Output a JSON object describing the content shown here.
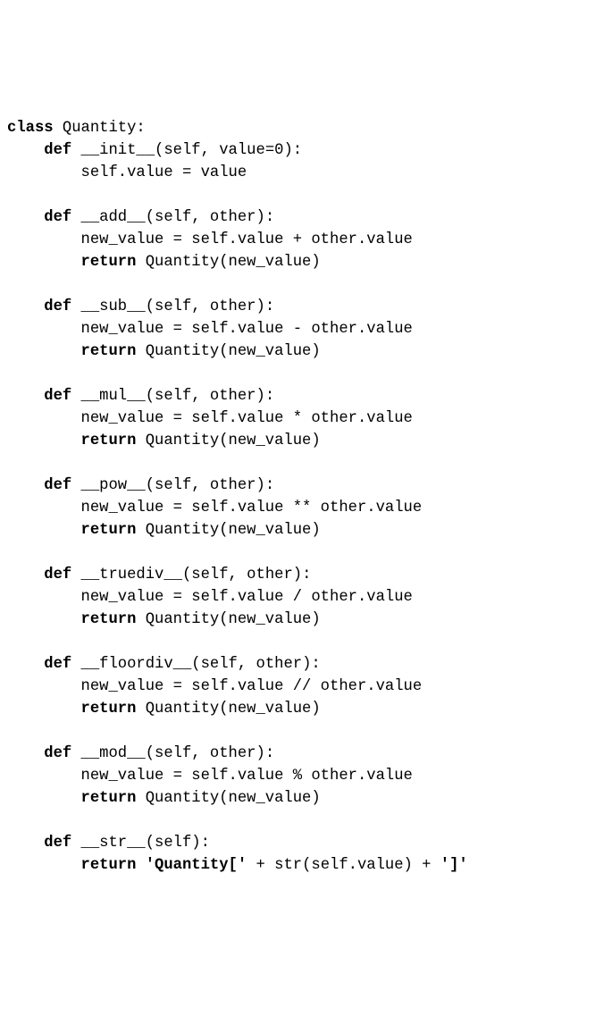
{
  "code": {
    "lines": [
      {
        "indent": 0,
        "segs": [
          {
            "t": "class ",
            "b": true
          },
          {
            "t": "Quantity:",
            "b": false
          }
        ]
      },
      {
        "indent": 1,
        "segs": [
          {
            "t": "def ",
            "b": true
          },
          {
            "t": "__init__(self, value=0):",
            "b": false
          }
        ]
      },
      {
        "indent": 2,
        "segs": [
          {
            "t": "self.value = value",
            "b": false
          }
        ]
      },
      {
        "indent": 0,
        "segs": [
          {
            "t": "",
            "b": false
          }
        ]
      },
      {
        "indent": 1,
        "segs": [
          {
            "t": "def ",
            "b": true
          },
          {
            "t": "__add__(self, other):",
            "b": false
          }
        ]
      },
      {
        "indent": 2,
        "segs": [
          {
            "t": "new_value = self.value + other.value",
            "b": false
          }
        ]
      },
      {
        "indent": 2,
        "segs": [
          {
            "t": "return ",
            "b": true
          },
          {
            "t": "Quantity(new_value)",
            "b": false
          }
        ]
      },
      {
        "indent": 0,
        "segs": [
          {
            "t": "",
            "b": false
          }
        ]
      },
      {
        "indent": 1,
        "segs": [
          {
            "t": "def ",
            "b": true
          },
          {
            "t": "__sub__(self, other):",
            "b": false
          }
        ]
      },
      {
        "indent": 2,
        "segs": [
          {
            "t": "new_value = self.value - other.value",
            "b": false
          }
        ]
      },
      {
        "indent": 2,
        "segs": [
          {
            "t": "return ",
            "b": true
          },
          {
            "t": "Quantity(new_value)",
            "b": false
          }
        ]
      },
      {
        "indent": 0,
        "segs": [
          {
            "t": "",
            "b": false
          }
        ]
      },
      {
        "indent": 1,
        "segs": [
          {
            "t": "def ",
            "b": true
          },
          {
            "t": "__mul__(self, other):",
            "b": false
          }
        ]
      },
      {
        "indent": 2,
        "segs": [
          {
            "t": "new_value = self.value * other.value",
            "b": false
          }
        ]
      },
      {
        "indent": 2,
        "segs": [
          {
            "t": "return ",
            "b": true
          },
          {
            "t": "Quantity(new_value)",
            "b": false
          }
        ]
      },
      {
        "indent": 0,
        "segs": [
          {
            "t": "",
            "b": false
          }
        ]
      },
      {
        "indent": 1,
        "segs": [
          {
            "t": "def ",
            "b": true
          },
          {
            "t": "__pow__(self, other):",
            "b": false
          }
        ]
      },
      {
        "indent": 2,
        "segs": [
          {
            "t": "new_value = self.value ** other.value",
            "b": false
          }
        ]
      },
      {
        "indent": 2,
        "segs": [
          {
            "t": "return ",
            "b": true
          },
          {
            "t": "Quantity(new_value)",
            "b": false
          }
        ]
      },
      {
        "indent": 0,
        "segs": [
          {
            "t": "",
            "b": false
          }
        ]
      },
      {
        "indent": 1,
        "segs": [
          {
            "t": "def ",
            "b": true
          },
          {
            "t": "__truediv__(self, other):",
            "b": false
          }
        ]
      },
      {
        "indent": 2,
        "segs": [
          {
            "t": "new_value = self.value / other.value",
            "b": false
          }
        ]
      },
      {
        "indent": 2,
        "segs": [
          {
            "t": "return ",
            "b": true
          },
          {
            "t": "Quantity(new_value)",
            "b": false
          }
        ]
      },
      {
        "indent": 0,
        "segs": [
          {
            "t": "",
            "b": false
          }
        ]
      },
      {
        "indent": 1,
        "segs": [
          {
            "t": "def ",
            "b": true
          },
          {
            "t": "__floordiv__(self, other):",
            "b": false
          }
        ]
      },
      {
        "indent": 2,
        "segs": [
          {
            "t": "new_value = self.value // other.value",
            "b": false
          }
        ]
      },
      {
        "indent": 2,
        "segs": [
          {
            "t": "return ",
            "b": true
          },
          {
            "t": "Quantity(new_value)",
            "b": false
          }
        ]
      },
      {
        "indent": 0,
        "segs": [
          {
            "t": "",
            "b": false
          }
        ]
      },
      {
        "indent": 1,
        "segs": [
          {
            "t": "def ",
            "b": true
          },
          {
            "t": "__mod__(self, other):",
            "b": false
          }
        ]
      },
      {
        "indent": 2,
        "segs": [
          {
            "t": "new_value = self.value % other.value",
            "b": false
          }
        ]
      },
      {
        "indent": 2,
        "segs": [
          {
            "t": "return ",
            "b": true
          },
          {
            "t": "Quantity(new_value)",
            "b": false
          }
        ]
      },
      {
        "indent": 0,
        "segs": [
          {
            "t": "",
            "b": false
          }
        ]
      },
      {
        "indent": 1,
        "segs": [
          {
            "t": "def ",
            "b": true
          },
          {
            "t": "__str__(self):",
            "b": false
          }
        ]
      },
      {
        "indent": 2,
        "segs": [
          {
            "t": "return 'Quantity[' ",
            "b": true
          },
          {
            "t": "+ str(self.value) + ",
            "b": false
          },
          {
            "t": "']'",
            "b": true
          }
        ]
      }
    ],
    "indent_unit": "    "
  }
}
